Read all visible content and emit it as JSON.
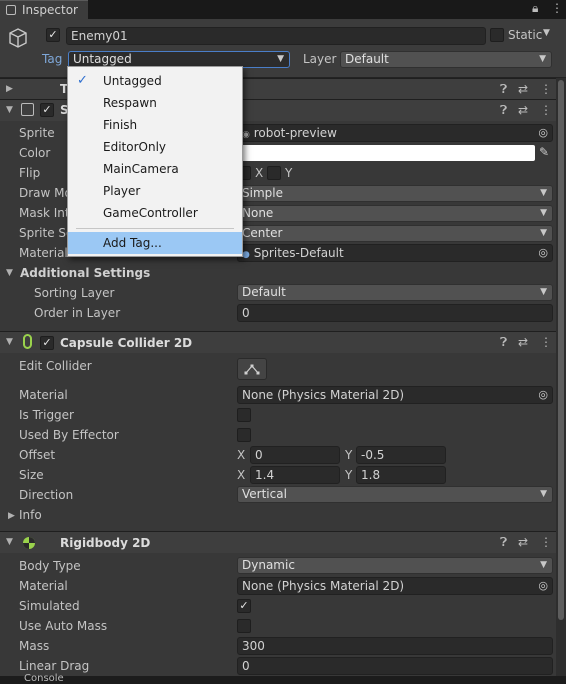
{
  "tab": {
    "title": "Inspector"
  },
  "header": {
    "active_checked": true,
    "object_name": "Enemy01",
    "static_label": "Static",
    "tag_label": "Tag",
    "tag_value": "Untagged",
    "layer_label": "Layer",
    "layer_value": "Default"
  },
  "tag_menu": {
    "items": [
      "Untagged",
      "Respawn",
      "Finish",
      "EditorOnly",
      "MainCamera",
      "Player",
      "GameController"
    ],
    "selected": "Untagged",
    "add_tag": "Add Tag..."
  },
  "transform": {
    "title": "T"
  },
  "sprite_renderer": {
    "title": "S",
    "sprite_label": "Sprite",
    "sprite_value": "robot-preview",
    "color_label": "Color",
    "color_value": "#ffffff",
    "flip_label": "Flip",
    "flip_x": "X",
    "flip_y": "Y",
    "draw_mode_label": "Draw Mo",
    "draw_mode_value": "Simple",
    "mask_label": "Mask Int",
    "mask_value": "None",
    "sort_point_label": "Sprite So",
    "sort_point_value": "Center",
    "material_label": "Material",
    "material_value": "Sprites-Default",
    "additional_label": "Additional Settings",
    "sorting_layer_label": "Sorting Layer",
    "sorting_layer_value": "Default",
    "order_label": "Order in Layer",
    "order_value": "0"
  },
  "capsule": {
    "title": "Capsule Collider 2D",
    "edit_label": "Edit Collider",
    "material_label": "Material",
    "material_value": "None (Physics Material 2D)",
    "trigger_label": "Is Trigger",
    "effector_label": "Used By Effector",
    "offset_label": "Offset",
    "offset_x": "0",
    "offset_y": "-0.5",
    "size_label": "Size",
    "size_x": "1.4",
    "size_y": "1.8",
    "direction_label": "Direction",
    "direction_value": "Vertical",
    "info_label": "Info",
    "x": "X",
    "y": "Y"
  },
  "rigidbody": {
    "title": "Rigidbody 2D",
    "body_type_label": "Body Type",
    "body_type_value": "Dynamic",
    "material_label": "Material",
    "material_value": "None (Physics Material 2D)",
    "simulated_label": "Simulated",
    "simulated": true,
    "auto_mass_label": "Use Auto Mass",
    "auto_mass": false,
    "mass_label": "Mass",
    "mass_value": "300",
    "linear_drag_label": "Linear Drag",
    "linear_drag_value": "0"
  },
  "bottom_tab": {
    "title": "Console"
  }
}
